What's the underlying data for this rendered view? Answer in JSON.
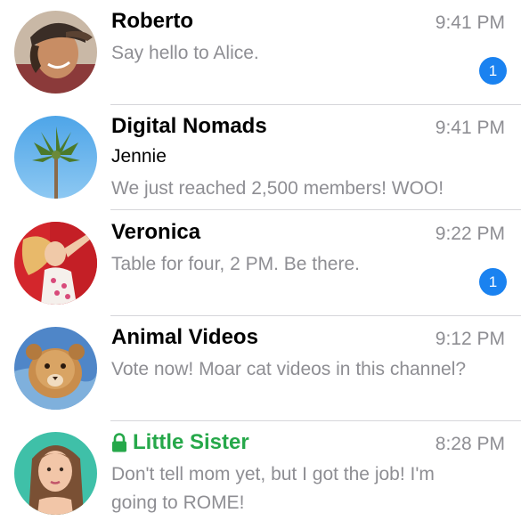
{
  "colors": {
    "accent": "#1a82f0",
    "secret_chat": "#26a84a",
    "secondary_text": "#8e8e93",
    "divider": "#d6d6da"
  },
  "chats": [
    {
      "title": "Roberto",
      "time": "9:41 PM",
      "preview": "Say hello to Alice.",
      "unread": "1",
      "avatar": "person-photo"
    },
    {
      "title": "Digital Nomads",
      "time": "9:41 PM",
      "sender": "Jennie",
      "preview": "We just reached 2,500 members! WOO!",
      "avatar": "palm-tree-photo"
    },
    {
      "title": "Veronica",
      "time": "9:22 PM",
      "preview": "Table for four, 2 PM. Be there.",
      "unread": "1",
      "avatar": "person-photo"
    },
    {
      "title": "Animal Videos",
      "time": "9:12 PM",
      "preview": "Vote now! Moar cat videos in this channel?",
      "avatar": "lion-cub-photo"
    },
    {
      "title": "Little Sister",
      "time": "8:28 PM",
      "preview": "Don't tell mom yet, but I got the job! I'm going to ROME!",
      "secret": true,
      "icon": "lock-icon",
      "avatar": "person-photo"
    }
  ]
}
